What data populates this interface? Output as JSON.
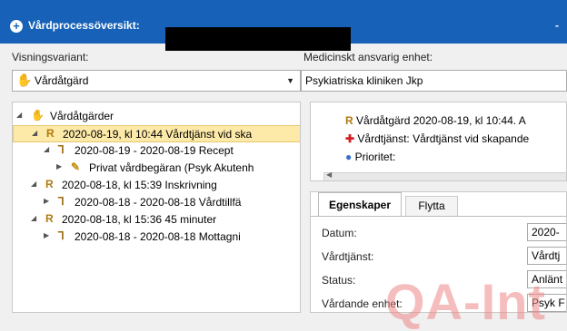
{
  "window": {
    "title": "Vårdprocessöversikt:",
    "title_icon": "plus-circle-icon",
    "title_right_mark": "-"
  },
  "filters": {
    "variant_label": "Visningsvariant:",
    "variant_value": "Vårdåtgärd",
    "unit_label": "Medicinskt ansvarig enhet:",
    "unit_value": "Psykiatriska kliniken Jkp"
  },
  "tree": {
    "root": "Vårdåtgärder",
    "items": [
      {
        "text": "2020-08-19, kl 10:44  Vårdtjänst vid ska",
        "icon": "R"
      },
      {
        "text": "2020-08-19 - 2020-08-19 Recept",
        "icon": "H"
      },
      {
        "text": "Privat vårdbegäran (Psyk Akutenh",
        "icon": "doc"
      },
      {
        "text": "2020-08-18, kl 15:39  Inskrivning",
        "icon": "R"
      },
      {
        "text": "2020-08-18 - 2020-08-18 Vårdtillfä",
        "icon": "H"
      },
      {
        "text": "2020-08-18, kl 15:36  45 minuter",
        "icon": "R"
      },
      {
        "text": "2020-08-18 - 2020-08-18 Mottagni",
        "icon": "H"
      }
    ]
  },
  "details": {
    "line1": "Vårdåtgärd 2020-08-19, kl 10:44. A",
    "line2": "Vårdtjänst: Vårdtjänst vid skapande",
    "line3": "Prioritet:"
  },
  "tabs": {
    "active": "Egenskaper",
    "inactive": "Flytta"
  },
  "properties": [
    {
      "label": "Datum:",
      "value": "2020-"
    },
    {
      "label": "Vårdtjänst:",
      "value": "Vårdtj"
    },
    {
      "label": "Status:",
      "value": "Anlänt"
    },
    {
      "label": "Vårdande enhet:",
      "value": "Psyk F"
    }
  ],
  "watermark": "QA-Int"
}
